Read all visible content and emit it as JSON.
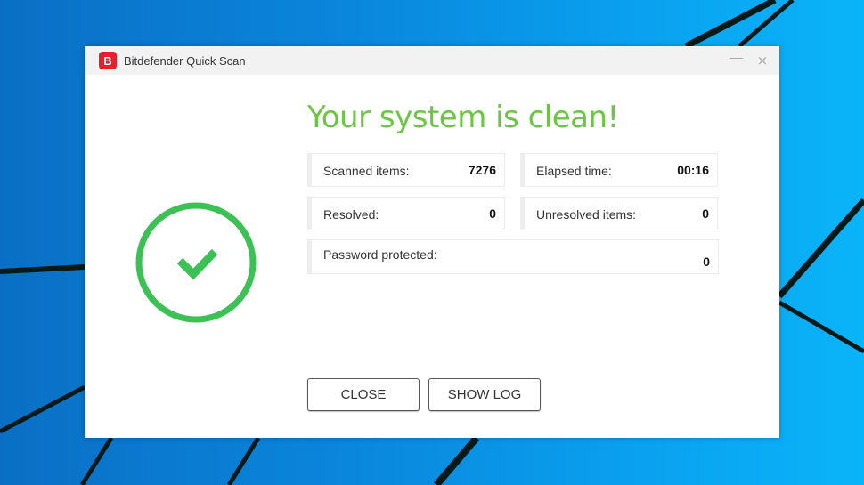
{
  "window": {
    "title": "Bitdefender Quick Scan",
    "logo_letter": "B",
    "minimize_label": "—",
    "close_symbol": "×"
  },
  "status": {
    "headline": "Your system is clean!",
    "icon": "check-circle-icon",
    "color": "#3cc154"
  },
  "stats": {
    "scanned": {
      "label": "Scanned items:",
      "value": "7276"
    },
    "elapsed": {
      "label": "Elapsed time:",
      "value": "00:16"
    },
    "resolved": {
      "label": "Resolved:",
      "value": "0"
    },
    "unresolved": {
      "label": "Unresolved items:",
      "value": "0"
    },
    "password": {
      "label": "Password protected:",
      "value": "0"
    }
  },
  "buttons": {
    "close": "CLOSE",
    "show_log": "SHOW LOG"
  },
  "colors": {
    "brand_red": "#e3202b",
    "headline_green": "#6cc644",
    "success_green": "#3cc154"
  }
}
